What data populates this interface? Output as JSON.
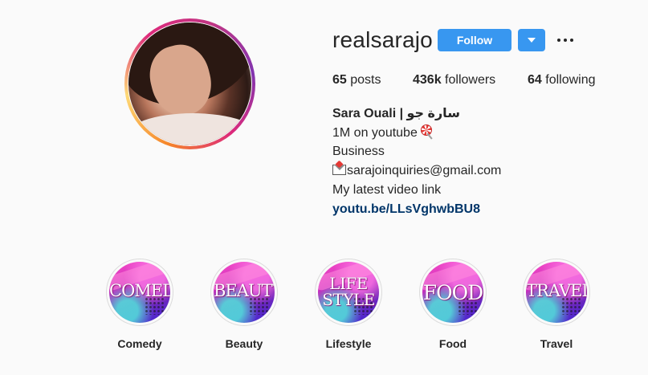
{
  "profile": {
    "username": "realsarajo",
    "follow_label": "Follow",
    "stats": {
      "posts_count": "65",
      "posts_label": "posts",
      "followers_count": "436k",
      "followers_label": "followers",
      "following_count": "64",
      "following_label": "following"
    },
    "bio": {
      "name": "Sara Ouali | سارة جو",
      "line1": "1M on youtube",
      "line2": "Business",
      "email": "sarajoinquiries@gmail.com",
      "line4": "My latest video link",
      "link": "youtu.be/LLsVghwbBU8"
    }
  },
  "highlights": [
    {
      "cover_line1": "COMEDY",
      "cover_line2": "",
      "label": "Comedy"
    },
    {
      "cover_line1": "BEAUTY",
      "cover_line2": "",
      "label": "Beauty"
    },
    {
      "cover_line1": "LIFE",
      "cover_line2": "STYLE",
      "label": "Lifestyle"
    },
    {
      "cover_line1": "FOOD",
      "cover_line2": "",
      "label": "Food"
    },
    {
      "cover_line1": "TRAVEL",
      "cover_line2": "",
      "label": "Travel"
    }
  ],
  "icons": {
    "more": "more-options-icon",
    "dropdown": "chevron-down-icon",
    "lollipop": "lollipop-emoji",
    "mail": "love-letter-emoji"
  },
  "colors": {
    "accent": "#3897f0",
    "link": "#003569",
    "background": "#fafafa",
    "text": "#262626"
  }
}
